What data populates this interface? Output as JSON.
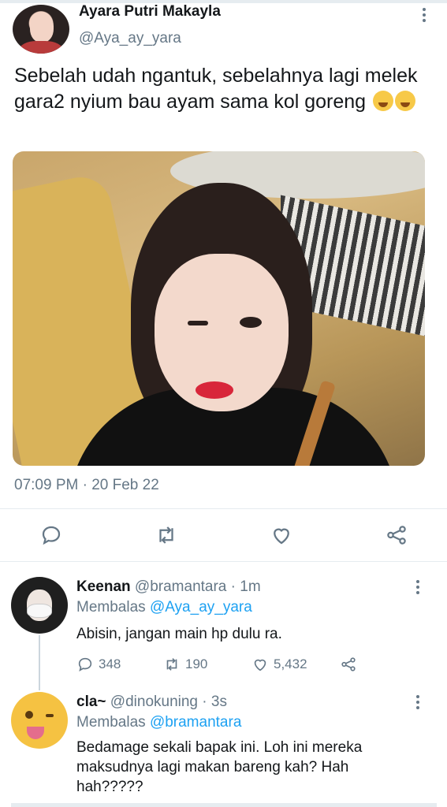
{
  "tweet": {
    "author_name": "Ayara Putri Makayla",
    "author_handle": "@Aya_ay_yara",
    "text": "Sebelah udah ngantuk, sebelahnya lagi melek gara2 nyium bau ayam sama kol goreng",
    "emojis": [
      "crying-face",
      "rolling-laughing-face"
    ],
    "timestamp": "07:09 PM · 20 Feb 22",
    "actions": [
      "reply-icon",
      "retweet-icon",
      "like-icon",
      "share-icon"
    ]
  },
  "replies": [
    {
      "name": "Keenan",
      "handle": "@bramantara",
      "time": "· 1m",
      "replying_prefix": "Membalas",
      "replying_to": "@Aya_ay_yara",
      "text": "Abisin, jangan main hp dulu ra.",
      "replies_count": "348",
      "retweets_count": "190",
      "likes_count": "5,432"
    },
    {
      "name": "cla~",
      "handle": "@dinokuning",
      "time": "· 3s",
      "replying_prefix": "Membalas",
      "replying_to": "@bramantara",
      "text": "Bedamage sekali bapak ini. Loh ini mereka maksudnya lagi makan bareng kah? Hah hah?????"
    }
  ],
  "colors": {
    "accent": "#1da1f2",
    "secondary_text": "#657786",
    "primary_text": "#14171a",
    "divider": "#e6ecf0"
  }
}
